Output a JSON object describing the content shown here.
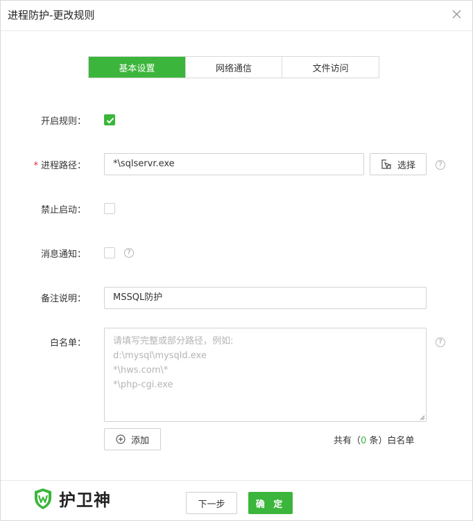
{
  "dialog": {
    "title": "进程防护-更改规则"
  },
  "tabs": [
    {
      "label": "基本设置",
      "active": true
    },
    {
      "label": "网络通信",
      "active": false
    },
    {
      "label": "文件访问",
      "active": false
    }
  ],
  "form": {
    "enable_rule": {
      "label": "开启规则：",
      "checked": true
    },
    "process_path": {
      "required_mark": "*",
      "label": "进程路径：",
      "value": "*\\sqlservr.exe",
      "select_button": "选择"
    },
    "forbid_start": {
      "label": "禁止启动：",
      "checked": false
    },
    "notify": {
      "label": "消息通知：",
      "checked": false
    },
    "remark": {
      "label": "备注说明：",
      "value": "MSSQL防护"
    },
    "whitelist": {
      "label": "白名单：",
      "placeholder_lines": [
        "请填写完整或部分路径，例如:",
        "d:\\mysql\\mysqld.exe",
        "*\\hws.com\\*",
        "*\\php-cgi.exe"
      ],
      "add_button": "添加",
      "count_prefix": "共有（",
      "count": "0",
      "count_suffix": " 条）白名单"
    },
    "help_glyph": "?"
  },
  "footer": {
    "brand": "护卫神",
    "next_button": "下一步",
    "confirm_button": "确 定"
  },
  "colors": {
    "accent": "#3bb53b",
    "required": "#e0292a"
  },
  "icons": {
    "close": "close-icon",
    "check": "check-icon",
    "select": "cursor-select-icon",
    "add": "plus-circle-icon",
    "help": "question-circle-icon",
    "logo": "shield-w-logo"
  }
}
